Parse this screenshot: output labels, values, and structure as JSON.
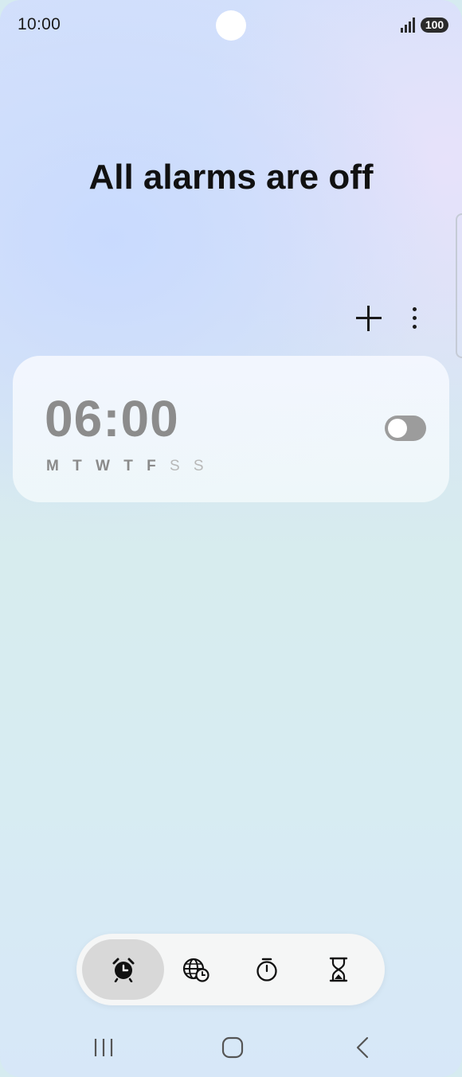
{
  "status_bar": {
    "time": "10:00",
    "battery": "100",
    "signal_icon": "signal-icon"
  },
  "header": {
    "title": "All alarms are off"
  },
  "toolbar": {
    "add_icon": "plus-icon",
    "more_icon": "more-vert-icon"
  },
  "alarms": [
    {
      "time": "06:00",
      "weekdays": "M T W T F",
      "weekend": "S S",
      "enabled": false
    }
  ],
  "tabs": [
    {
      "icon": "alarm-clock-icon",
      "active": true
    },
    {
      "icon": "world-clock-icon",
      "active": false
    },
    {
      "icon": "stopwatch-icon",
      "active": false
    },
    {
      "icon": "hourglass-timer-icon",
      "active": false
    }
  ],
  "nav_bar": {
    "recents_icon": "recents-icon",
    "home_icon": "home-icon",
    "back_icon": "back-icon"
  },
  "colors": {
    "title": "#111111",
    "alarm_time_off": "#8c8c8c",
    "toggle_off": "#9c9c9c"
  }
}
